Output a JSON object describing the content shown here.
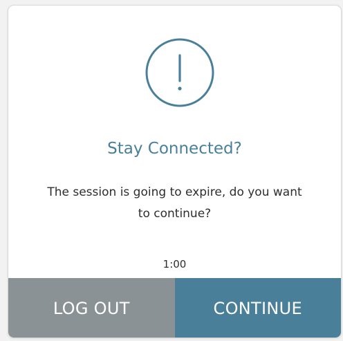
{
  "dialog": {
    "icon": "exclamation-circle-icon",
    "title": "Stay Connected?",
    "message_line1": "The session is going to expire, do you want",
    "message_line2": "to continue?",
    "timer": "1:00",
    "logout_label": "LOG OUT",
    "continue_label": "CONTINUE"
  },
  "colors": {
    "accent": "#4a7f99",
    "logout_bg": "#8b9295",
    "continue_bg": "#4a7f99",
    "text": "#2d2d2d"
  }
}
